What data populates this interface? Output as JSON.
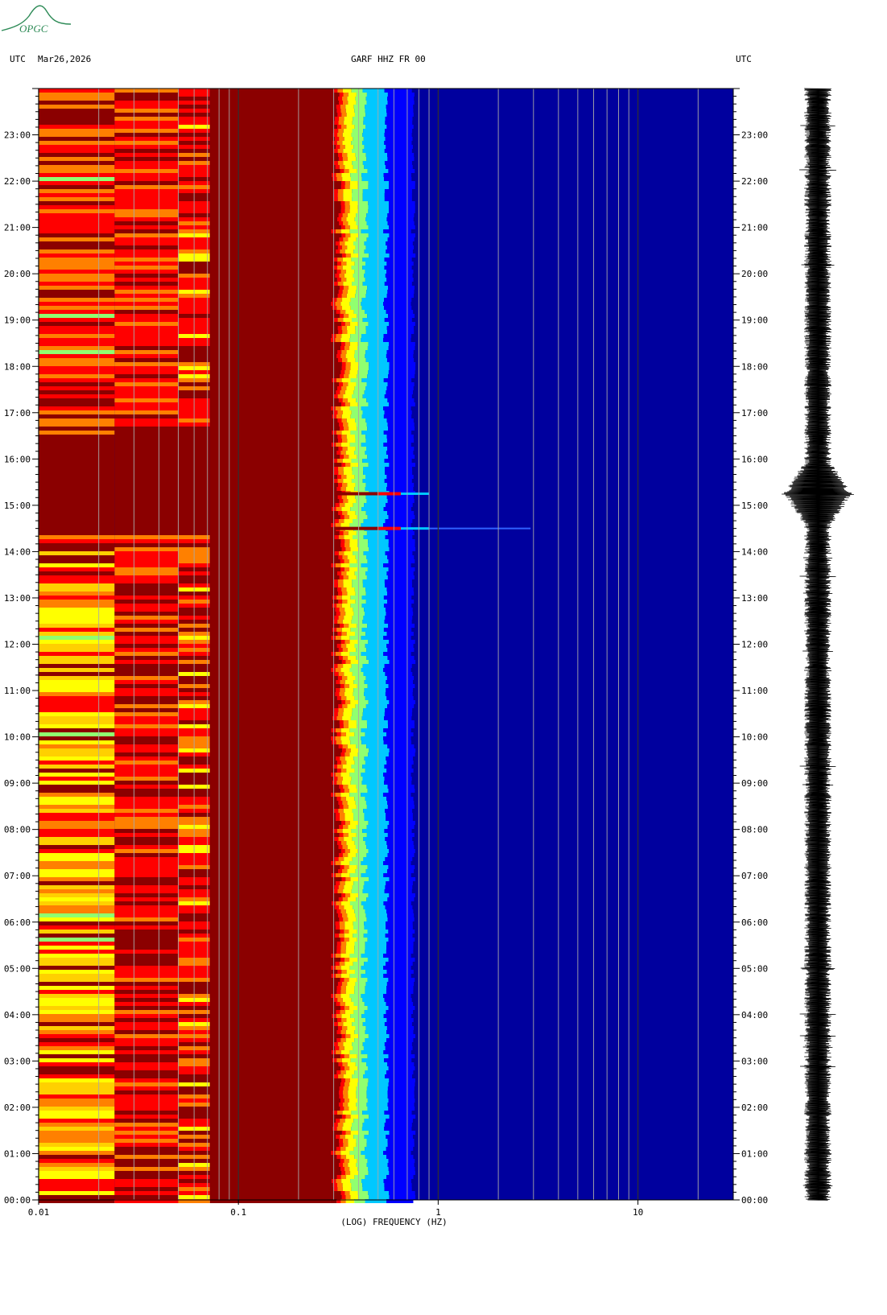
{
  "header": {
    "left_tz": "UTC",
    "date": "Mar26,2026",
    "station": "GARF HHZ FR 00",
    "right_tz": "UTC"
  },
  "logo": {
    "text": "OPGC"
  },
  "chart_data": {
    "type": "heatmap",
    "title": "GARF HHZ FR 00",
    "xlabel": "(LOG) FREQUENCY (HZ)",
    "ylabel": "",
    "x_scale": "log",
    "xlim": [
      0.01,
      30
    ],
    "ylim_hours": [
      0,
      24
    ],
    "x_ticks": [
      {
        "value": 0.01,
        "label": "0.01"
      },
      {
        "value": 0.1,
        "label": "0.1"
      },
      {
        "value": 1,
        "label": "1"
      },
      {
        "value": 10,
        "label": "10"
      }
    ],
    "y_ticks": [
      "00:00",
      "01:00",
      "02:00",
      "03:00",
      "04:00",
      "05:00",
      "06:00",
      "07:00",
      "08:00",
      "09:00",
      "10:00",
      "11:00",
      "12:00",
      "13:00",
      "14:00",
      "15:00",
      "16:00",
      "17:00",
      "18:00",
      "19:00",
      "20:00",
      "21:00",
      "22:00",
      "23:00"
    ],
    "grid": true,
    "colormap": [
      "#00009e",
      "#0000ff",
      "#00c8ff",
      "#90ff70",
      "#ffff00",
      "#ff8000",
      "#ff0000",
      "#8b0000"
    ],
    "events": [
      {
        "time_utc": "14:30",
        "max_freq_hz": 2.9
      },
      {
        "time_utc": "15:15",
        "max_freq_hz": 0.6
      }
    ],
    "seismogram": {
      "position": "right",
      "large_amplitude_utc": "15:15"
    }
  },
  "colors": {
    "background": "#ffffff",
    "low_power": "#00009e",
    "high_power": "#8b0000",
    "logo": "#2e8b57"
  }
}
